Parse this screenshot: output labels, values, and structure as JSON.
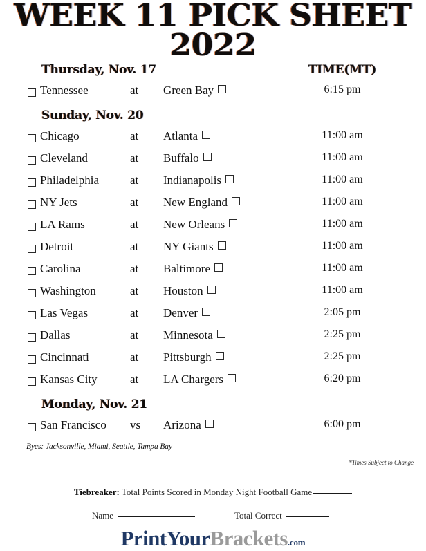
{
  "title": {
    "line1": "WEEK 11 PICK SHEET",
    "line2": "2022"
  },
  "columns": {
    "time_header": "TIME(MT)"
  },
  "sections": [
    {
      "day_label": "Thursday, Nov. 17",
      "games": [
        {
          "away": "Tennessee",
          "sep": "at",
          "home": "Green Bay",
          "time": "6:15 pm"
        }
      ]
    },
    {
      "day_label": "Sunday, Nov. 20",
      "games": [
        {
          "away": "Chicago",
          "sep": "at",
          "home": "Atlanta",
          "time": "11:00 am"
        },
        {
          "away": "Cleveland",
          "sep": "at",
          "home": "Buffalo",
          "time": "11:00 am"
        },
        {
          "away": "Philadelphia",
          "sep": "at",
          "home": "Indianapolis",
          "time": "11:00 am"
        },
        {
          "away": "NY Jets",
          "sep": "at",
          "home": "New England",
          "time": "11:00 am"
        },
        {
          "away": "LA Rams",
          "sep": "at",
          "home": "New Orleans",
          "time": "11:00 am"
        },
        {
          "away": "Detroit",
          "sep": "at",
          "home": "NY Giants",
          "time": "11:00 am"
        },
        {
          "away": "Carolina",
          "sep": "at",
          "home": "Baltimore",
          "time": "11:00 am"
        },
        {
          "away": "Washington",
          "sep": "at",
          "home": "Houston",
          "time": "11:00 am"
        },
        {
          "away": "Las Vegas",
          "sep": "at",
          "home": "Denver",
          "time": "2:05 pm"
        },
        {
          "away": "Dallas",
          "sep": "at",
          "home": "Minnesota",
          "time": "2:25 pm"
        },
        {
          "away": "Cincinnati",
          "sep": "at",
          "home": "Pittsburgh",
          "time": "2:25 pm"
        },
        {
          "away": "Kansas City",
          "sep": "at",
          "home": "LA Chargers",
          "time": "6:20 pm"
        }
      ]
    },
    {
      "day_label": "Monday, Nov. 21",
      "games": [
        {
          "away": "San Francisco",
          "sep": "vs",
          "home": "Arizona",
          "time": "6:00 pm"
        }
      ]
    }
  ],
  "byes": "Byes: Jacksonville, Miami, Seattle, Tampa Bay",
  "times_note": "*Times Subject to Change",
  "tiebreaker": {
    "label": "Tiebreaker:",
    "text": "Total Points Scored in Monday Night Football Game"
  },
  "footer": {
    "name_label": "Name",
    "total_correct_label": "Total Correct"
  },
  "logo": {
    "part1": "PrintYour",
    "part2": "Brackets",
    "part3": ".com",
    "color_navy": "#1f3864",
    "color_gray": "#9a9a9a"
  }
}
